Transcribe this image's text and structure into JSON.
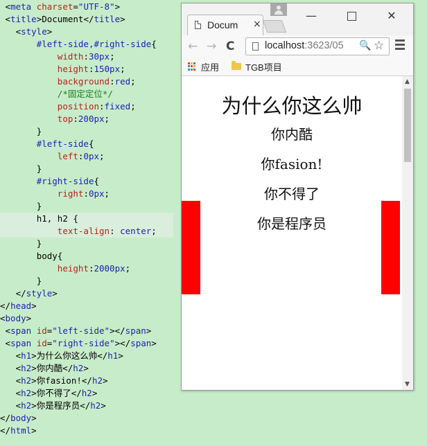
{
  "editor": {
    "lines": [
      {
        "indent": " ",
        "parts": [
          [
            "pun",
            "<"
          ],
          [
            "tag",
            "meta"
          ],
          [
            "pun",
            " "
          ],
          [
            "attr",
            "charset"
          ],
          [
            "pun",
            "="
          ],
          [
            "str",
            "\"UTF-8\""
          ],
          [
            "pun",
            ">"
          ]
        ]
      },
      {
        "indent": " ",
        "parts": [
          [
            "pun",
            "<"
          ],
          [
            "tag",
            "title"
          ],
          [
            "pun",
            ">"
          ],
          [
            "pun",
            "Document"
          ],
          [
            "pun",
            "</"
          ],
          [
            "tag",
            "title"
          ],
          [
            "pun",
            ">"
          ]
        ]
      },
      {
        "indent": "   ",
        "parts": [
          [
            "pun",
            "<"
          ],
          [
            "tag",
            "style"
          ],
          [
            "pun",
            ">"
          ]
        ]
      },
      {
        "indent": "       ",
        "parts": [
          [
            "sel",
            "#left-side,#right-side"
          ],
          [
            "pun",
            "{"
          ]
        ]
      },
      {
        "indent": "           ",
        "parts": [
          [
            "prop",
            "width"
          ],
          [
            "pun",
            ":"
          ],
          [
            "val",
            "30px"
          ],
          [
            "pun",
            ";"
          ]
        ]
      },
      {
        "indent": "           ",
        "parts": [
          [
            "prop",
            "height"
          ],
          [
            "pun",
            ":"
          ],
          [
            "val",
            "150px"
          ],
          [
            "pun",
            ";"
          ]
        ]
      },
      {
        "indent": "           ",
        "parts": [
          [
            "prop",
            "background"
          ],
          [
            "pun",
            ":"
          ],
          [
            "val",
            "red"
          ],
          [
            "pun",
            ";"
          ]
        ]
      },
      {
        "indent": "           ",
        "parts": [
          [
            "com",
            "/*固定定位*/"
          ]
        ]
      },
      {
        "indent": "           ",
        "parts": [
          [
            "prop",
            "position"
          ],
          [
            "pun",
            ":"
          ],
          [
            "val",
            "fixed"
          ],
          [
            "pun",
            ";"
          ]
        ]
      },
      {
        "indent": "           ",
        "parts": [
          [
            "prop",
            "top"
          ],
          [
            "pun",
            ":"
          ],
          [
            "val",
            "200px"
          ],
          [
            "pun",
            ";"
          ]
        ]
      },
      {
        "indent": "       ",
        "parts": [
          [
            "pun",
            "}"
          ]
        ]
      },
      {
        "indent": "       ",
        "parts": [
          [
            "sel",
            "#left-side"
          ],
          [
            "pun",
            "{"
          ]
        ]
      },
      {
        "indent": "           ",
        "parts": [
          [
            "prop",
            "left"
          ],
          [
            "pun",
            ":"
          ],
          [
            "val",
            "0px"
          ],
          [
            "pun",
            ";"
          ]
        ]
      },
      {
        "indent": "       ",
        "parts": [
          [
            "pun",
            "}"
          ]
        ]
      },
      {
        "indent": "       ",
        "parts": [
          [
            "sel",
            "#right-side"
          ],
          [
            "pun",
            "{"
          ]
        ]
      },
      {
        "indent": "           ",
        "parts": [
          [
            "prop",
            "right"
          ],
          [
            "pun",
            ":"
          ],
          [
            "val",
            "0px"
          ],
          [
            "pun",
            ";"
          ]
        ]
      },
      {
        "indent": "       ",
        "parts": [
          [
            "pun",
            "}"
          ]
        ]
      },
      {
        "indent": "       ",
        "parts": [
          [
            "pun",
            "h1, h2 {"
          ]
        ],
        "highlight": true
      },
      {
        "indent": "           ",
        "parts": [
          [
            "prop",
            "text-align"
          ],
          [
            "pun",
            ": "
          ],
          [
            "val",
            "center"
          ],
          [
            "pun",
            ";"
          ]
        ],
        "highlight": true
      },
      {
        "indent": "       ",
        "parts": [
          [
            "pun",
            "}"
          ]
        ]
      },
      {
        "indent": "       ",
        "parts": [
          [
            "pun",
            "body{"
          ]
        ]
      },
      {
        "indent": "           ",
        "parts": [
          [
            "prop",
            "height"
          ],
          [
            "pun",
            ":"
          ],
          [
            "val",
            "2000px"
          ],
          [
            "pun",
            ";"
          ]
        ]
      },
      {
        "indent": "       ",
        "parts": [
          [
            "pun",
            "}"
          ]
        ]
      },
      {
        "indent": "   ",
        "parts": [
          [
            "pun",
            "</"
          ],
          [
            "tag",
            "style"
          ],
          [
            "pun",
            ">"
          ]
        ]
      },
      {
        "indent": "",
        "parts": [
          [
            "pun",
            "</"
          ],
          [
            "tag",
            "head"
          ],
          [
            "pun",
            ">"
          ]
        ]
      },
      {
        "indent": "",
        "parts": [
          [
            "pun",
            "<"
          ],
          [
            "tag",
            "body"
          ],
          [
            "pun",
            ">"
          ]
        ]
      },
      {
        "indent": " ",
        "parts": [
          [
            "pun",
            "<"
          ],
          [
            "tag",
            "span"
          ],
          [
            "pun",
            " "
          ],
          [
            "attr",
            "id"
          ],
          [
            "pun",
            "="
          ],
          [
            "str",
            "\"left-side\""
          ],
          [
            "pun",
            "></"
          ],
          [
            "tag",
            "span"
          ],
          [
            "pun",
            ">"
          ]
        ]
      },
      {
        "indent": " ",
        "parts": [
          [
            "pun",
            "<"
          ],
          [
            "tag",
            "span"
          ],
          [
            "pun",
            " "
          ],
          [
            "attr",
            "id"
          ],
          [
            "pun",
            "="
          ],
          [
            "str",
            "\"right-side\""
          ],
          [
            "pun",
            "></"
          ],
          [
            "tag",
            "span"
          ],
          [
            "pun",
            ">"
          ]
        ]
      },
      {
        "indent": "   ",
        "parts": [
          [
            "pun",
            "<"
          ],
          [
            "tag",
            "h1"
          ],
          [
            "pun",
            ">"
          ],
          [
            "pun",
            "为什么你这么帅"
          ],
          [
            "pun",
            "</"
          ],
          [
            "tag",
            "h1"
          ],
          [
            "pun",
            ">"
          ]
        ]
      },
      {
        "indent": "   ",
        "parts": [
          [
            "pun",
            "<"
          ],
          [
            "tag",
            "h2"
          ],
          [
            "pun",
            ">"
          ],
          [
            "pun",
            "你内酷"
          ],
          [
            "pun",
            "</"
          ],
          [
            "tag",
            "h2"
          ],
          [
            "pun",
            ">"
          ]
        ]
      },
      {
        "indent": "   ",
        "parts": [
          [
            "pun",
            "<"
          ],
          [
            "tag",
            "h2"
          ],
          [
            "pun",
            ">"
          ],
          [
            "pun",
            "你fasion!"
          ],
          [
            "pun",
            "</"
          ],
          [
            "tag",
            "h2"
          ],
          [
            "pun",
            ">"
          ]
        ]
      },
      {
        "indent": "   ",
        "parts": [
          [
            "pun",
            "<"
          ],
          [
            "tag",
            "h2"
          ],
          [
            "pun",
            ">"
          ],
          [
            "pun",
            "你不得了"
          ],
          [
            "pun",
            "</"
          ],
          [
            "tag",
            "h2"
          ],
          [
            "pun",
            ">"
          ]
        ]
      },
      {
        "indent": "   ",
        "parts": [
          [
            "pun",
            "<"
          ],
          [
            "tag",
            "h2"
          ],
          [
            "pun",
            ">"
          ],
          [
            "pun",
            "你是程序员"
          ],
          [
            "pun",
            "</"
          ],
          [
            "tag",
            "h2"
          ],
          [
            "pun",
            ">"
          ]
        ]
      },
      {
        "indent": "",
        "parts": [
          [
            "pun",
            "</"
          ],
          [
            "tag",
            "body"
          ],
          [
            "pun",
            ">"
          ]
        ]
      },
      {
        "indent": "",
        "parts": [
          [
            "pun",
            "</"
          ],
          [
            "tag",
            "html"
          ],
          [
            "pun",
            ">"
          ]
        ]
      }
    ]
  },
  "browser": {
    "tab_title": "Docum",
    "tab_close": "×",
    "win_min": "—",
    "win_close": "✕",
    "nav_back": "←",
    "nav_forward": "→",
    "nav_reload": "C",
    "url_host": "localhost",
    "url_rest": ":3623/05",
    "zoom_glyph": "🔍",
    "star_glyph": "☆",
    "bookmarks": {
      "apps": "应用",
      "folder": "TGB项目"
    },
    "apps_colors": [
      "#e8453c",
      "#f9bb2d",
      "#3b82f6",
      "#34a853",
      "#e8453c",
      "#f9bb2d",
      "#3b82f6",
      "#34a853",
      "#e8453c"
    ],
    "scroll_up": "▲",
    "scroll_down": "▼"
  },
  "page": {
    "h1": "为什么你这么帅",
    "h2": [
      "你内酷",
      "你fasion!",
      "你不得了",
      "你是程序员"
    ],
    "side_color": "#ff0000"
  }
}
